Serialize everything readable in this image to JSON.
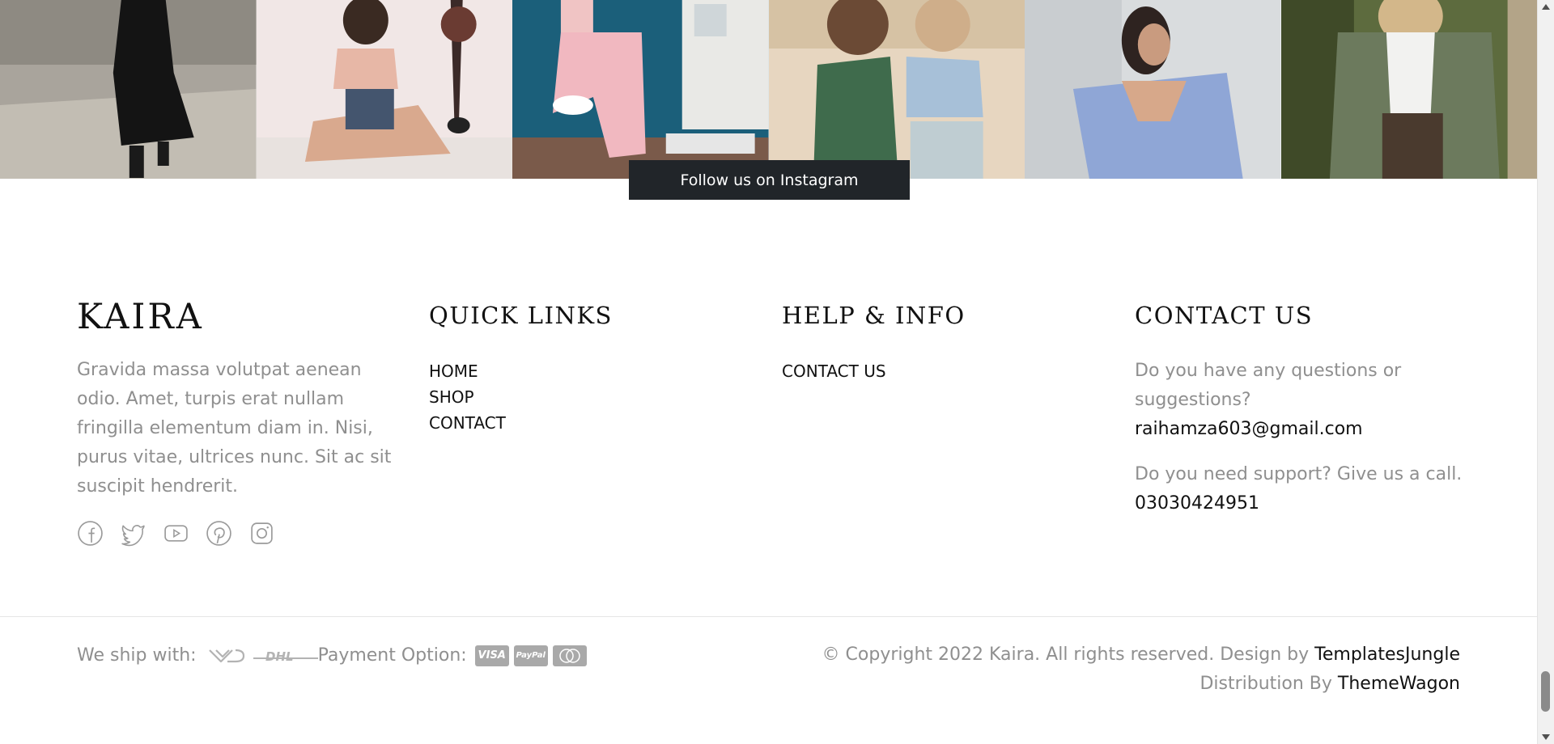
{
  "instagram": {
    "follow_label": "Follow us on Instagram"
  },
  "footer": {
    "brand": "KAIRA",
    "about": "Gravida massa volutpat aenean odio. Amet, turpis erat nullam fringilla elementum diam in. Nisi, purus vitae, ultrices nunc. Sit ac sit suscipit hendrerit.",
    "social": [
      "facebook-icon",
      "twitter-icon",
      "youtube-icon",
      "pinterest-icon",
      "instagram-icon"
    ],
    "quick_links": {
      "title": "QUICK LINKS",
      "items": [
        "HOME",
        "SHOP",
        "CONTACT"
      ]
    },
    "help_info": {
      "title": "HELP & INFO",
      "items": [
        "CONTACT US"
      ]
    },
    "contact": {
      "title": "CONTACT US",
      "question": "Do you have any questions or suggestions?",
      "email": "raihamza603@gmail.com",
      "support": "Do you need support? Give us a call.",
      "phone": "03030424951"
    }
  },
  "bottom": {
    "ship_label": "We ship with:",
    "ship_partners": [
      "carrier-logo",
      "DHL"
    ],
    "payment_label": "Payment Option:",
    "payment_methods": [
      "VISA",
      "PayPal",
      "MasterCard"
    ],
    "copyright": "© Copyright 2022 Kaira. All rights reserved. Design by",
    "designer": "TemplatesJungle",
    "distribution_label": "Distribution By",
    "distributor": "ThemeWagon"
  },
  "colors": {
    "button_bg": "#212529",
    "heading": "#111111",
    "body_text": "#8f8f8f",
    "payment_badge": "#a9a9a9"
  }
}
